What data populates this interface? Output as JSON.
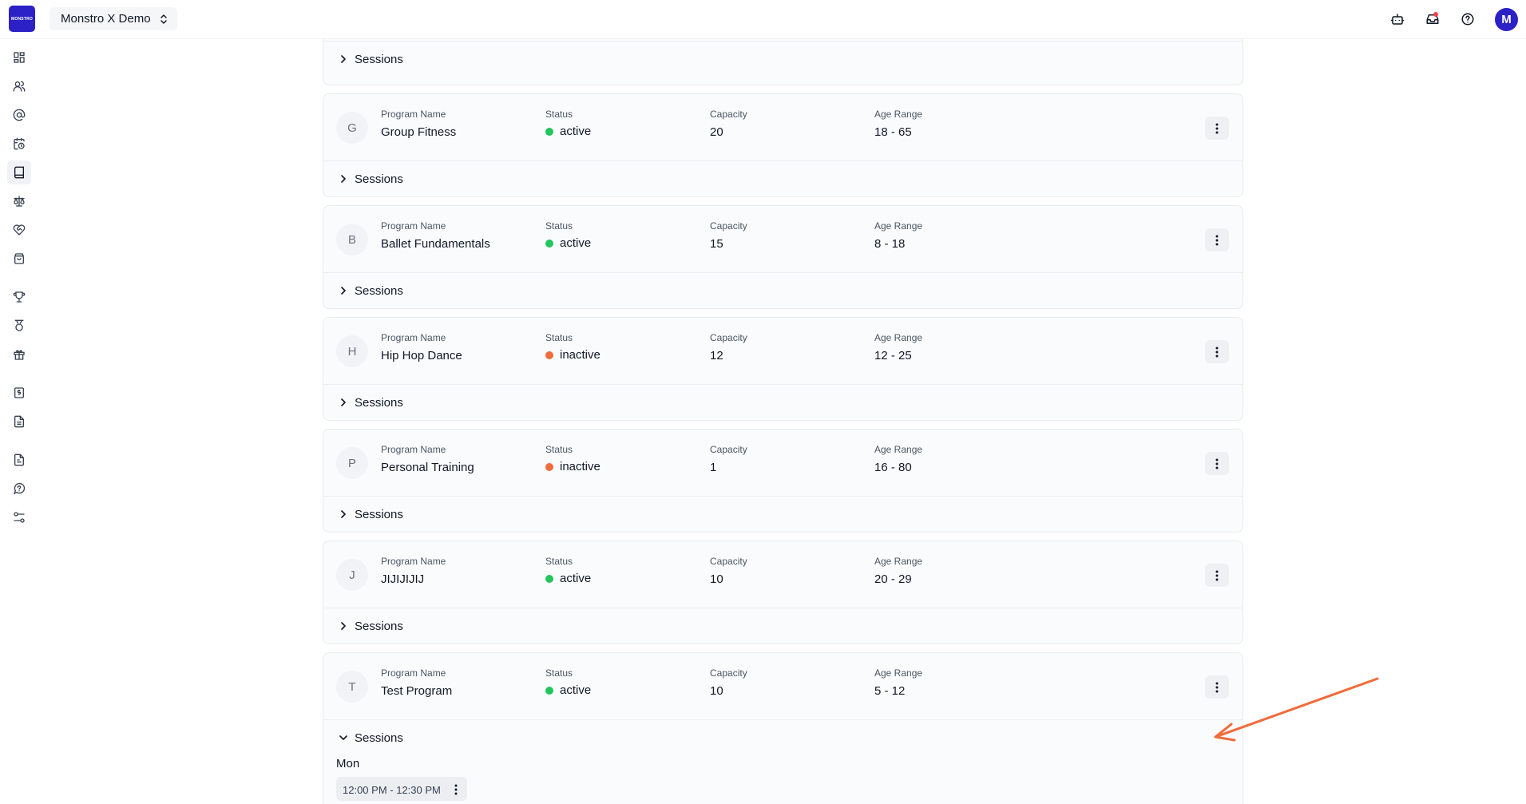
{
  "app": {
    "logo_text": "MONSTRO",
    "workspace": "Monstro X Demo",
    "avatar_initial": "M"
  },
  "top_icons": [
    "bot-icon",
    "inbox-icon",
    "help-icon"
  ],
  "sidebar_icons": [
    "dashboard-icon",
    "users-icon",
    "at-sign-icon",
    "calendar-clock-icon",
    "book-icon",
    "scale-icon",
    "heart-handshake-icon",
    "shopping-bag-icon",
    "trophy-icon",
    "medal-icon",
    "gift-icon",
    "dollar-doc-icon",
    "document-icon",
    "file-text-icon",
    "help-circle-icon",
    "settings-sliders-icon"
  ],
  "labels": {
    "program_name": "Program Name",
    "status": "Status",
    "capacity": "Capacity",
    "age_range": "Age Range",
    "sessions": "Sessions"
  },
  "colors": {
    "active": "#22c55e",
    "inactive": "#f26b3a",
    "brand": "#2b21c6",
    "annotation": "#f26b3a"
  },
  "programs": [
    {
      "letter": "G",
      "name": "Group Fitness",
      "status": "active",
      "capacity": "20",
      "age_range": "18 - 65"
    },
    {
      "letter": "B",
      "name": "Ballet Fundamentals",
      "status": "active",
      "capacity": "15",
      "age_range": "8 - 18"
    },
    {
      "letter": "H",
      "name": "Hip Hop Dance",
      "status": "inactive",
      "capacity": "12",
      "age_range": "12 - 25"
    },
    {
      "letter": "P",
      "name": "Personal Training",
      "status": "inactive",
      "capacity": "1",
      "age_range": "16 - 80"
    },
    {
      "letter": "J",
      "name": "JIJIJIJIJ",
      "status": "active",
      "capacity": "10",
      "age_range": "20 - 29"
    },
    {
      "letter": "T",
      "name": "Test Program",
      "status": "active",
      "capacity": "10",
      "age_range": "5 - 12"
    }
  ],
  "expanded_sessions": {
    "day": "Mon",
    "slot": "12:00 PM - 12:30 PM"
  }
}
